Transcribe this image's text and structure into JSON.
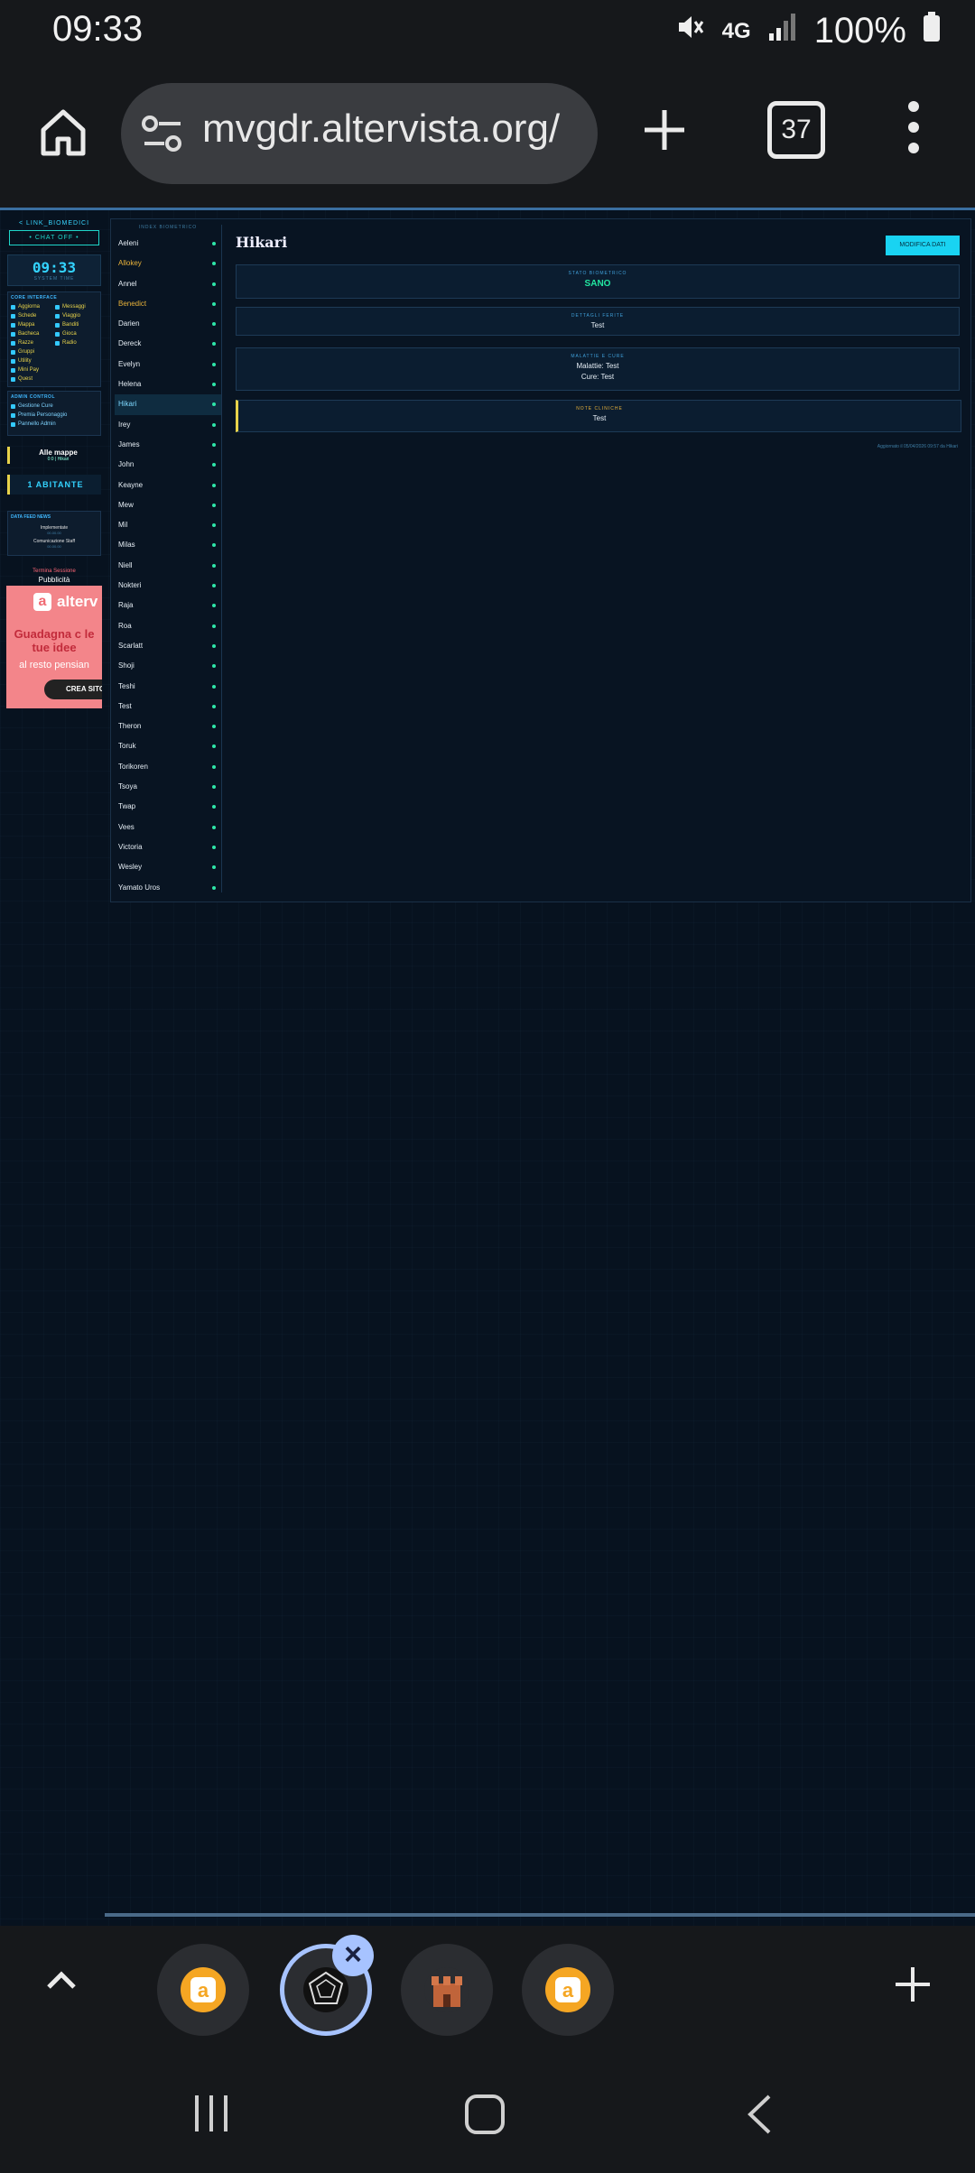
{
  "status": {
    "time": "09:33",
    "network": "4G",
    "battery": "100%"
  },
  "browser": {
    "url": "mvgdr.altervista.org/",
    "tab_count": "37"
  },
  "sidebar": {
    "link_header": "< LINK_BIOMEDICI",
    "chat_label": "• CHAT OFF •",
    "clock": "09:33",
    "clock_sub": "SYSTEM TIME",
    "core_header": "CORE INTERFACE",
    "nav_items": [
      "Aggiorna",
      "Messaggi",
      "Schede",
      "Viaggio",
      "Mappa",
      "Banditi",
      "Bacheca",
      "Gioca",
      "Razze",
      "Radio",
      "Gruppi",
      "",
      "Utility",
      "",
      "Mini Pay",
      "",
      "Quest",
      ""
    ],
    "admin_header": "ADMIN CONTROL",
    "admin_items": [
      "Gestione Cure",
      "Premia Personaggio",
      "Pannello Admin"
    ],
    "maps_title": "Alle mappe",
    "maps_sub": "0:0 | Hikari",
    "residents": "1 ABITANTE",
    "feed_header": "DATA FEED NEWS",
    "feed_items": [
      {
        "title": "Implementate",
        "date": "00.00.00"
      },
      {
        "title": "Comunicazione Staff",
        "date": "00.00.00"
      }
    ],
    "terminate": "Termina Sessione",
    "ad_label": "Pubblicità",
    "ad": {
      "brand": "alterv",
      "headline": "Guadagna c le tue idee",
      "subline": "al resto pensian",
      "cta": "CREA SITO"
    }
  },
  "characters": {
    "header": "INDEX BIOMETRICO",
    "names": [
      "Aeleni",
      "Allokey",
      "Annel",
      "Benedict",
      "Darien",
      "Dereck",
      "Evelyn",
      "Helena",
      "Hikari",
      "Irey",
      "James",
      "John",
      "Keayne",
      "Mew",
      "Mil",
      "Milas",
      "Niell",
      "Nokteri",
      "Raja",
      "Roa",
      "Scarlatt",
      "Shoji",
      "Teshi",
      "Test",
      "Theron",
      "Toruk",
      "Torikoren",
      "Tsoya",
      "Twap",
      "Vees",
      "Victoria",
      "Wesley",
      "Yamato Uros"
    ],
    "gold": [
      "Allokey",
      "Benedict"
    ],
    "active": "Hikari"
  },
  "detail": {
    "title": "Hikari",
    "edit_label": "MODIFICA DATI",
    "status_label": "STATO BIOMETRICO",
    "status_value": "SANO",
    "injury_label": "DETTAGLI FERITE",
    "injury_value": "Test",
    "disease_label": "MALATTIE E CURE",
    "disease_line": "Malattie: Test",
    "cure_line": "Cure: Test",
    "notes_label": "NOTE CLINICHE",
    "notes_value": "Test",
    "updated": "Aggiornato il 05/04/2026 09:57 da Hikari"
  },
  "tabstrip": {
    "tabs": [
      "altervista-icon",
      "dodecahedron-icon",
      "castle-icon",
      "altervista-icon"
    ]
  }
}
